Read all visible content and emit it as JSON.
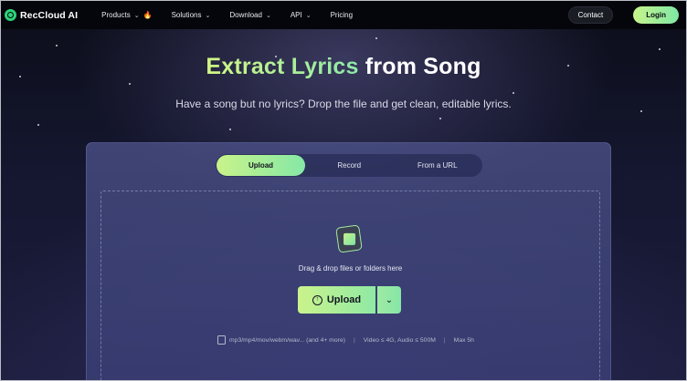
{
  "nav": {
    "brand": "RecCloud AI",
    "items": [
      {
        "label": "Products",
        "has_chevron": true,
        "badge": "🔥"
      },
      {
        "label": "Solutions",
        "has_chevron": true
      },
      {
        "label": "Download",
        "has_chevron": true
      },
      {
        "label": "API",
        "has_chevron": true
      },
      {
        "label": "Pricing",
        "has_chevron": false
      }
    ],
    "contact_label": "Contact",
    "login_label": "Login"
  },
  "hero": {
    "title_accent": "Extract Lyrics",
    "title_rest": "from Song",
    "subtitle": "Have a song but no lyrics? Drop the file and get clean, editable lyrics."
  },
  "card": {
    "tabs": [
      {
        "label": "Upload",
        "active": true
      },
      {
        "label": "Record",
        "active": false
      },
      {
        "label": "From a URL",
        "active": false
      }
    ],
    "drag_text": "Drag & drop files or folders here",
    "upload_label": "Upload",
    "formats": "mp3/mp4/mov/webm/wav... (and 4+ more)",
    "size_limit": "Video ≤ 4G, Audio ≤ 500M",
    "duration_limit": "Max 5h"
  },
  "colors": {
    "accent_start": "#cbf38c",
    "accent_end": "#85e8a6",
    "nav_bg": "#05060b",
    "card_bg": "#4e548c"
  },
  "icons": [
    "logo-icon",
    "chevron-down-icon",
    "fire-icon",
    "folder-file-icon",
    "upload-arrow-icon",
    "file-format-icon"
  ]
}
